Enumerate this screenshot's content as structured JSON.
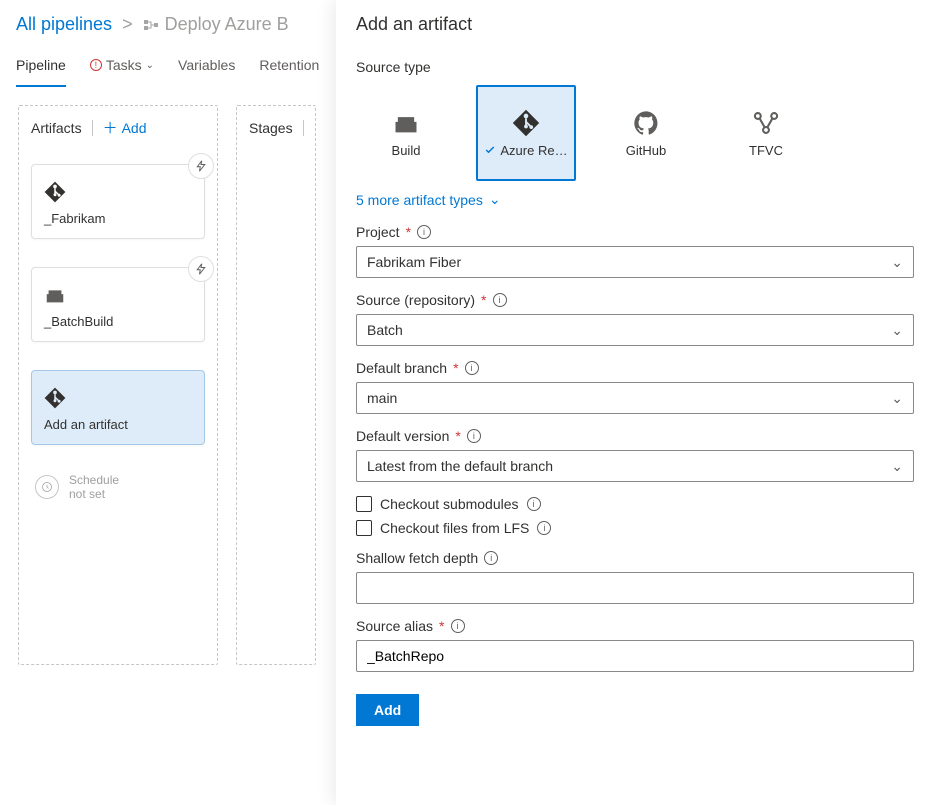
{
  "breadcrumb": {
    "parent": "All pipelines",
    "current": "Deploy Azure B"
  },
  "tabs": {
    "pipeline": "Pipeline",
    "tasks": "Tasks",
    "variables": "Variables",
    "retention": "Retention"
  },
  "artifacts": {
    "header": "Artifacts",
    "add": "Add",
    "items": [
      {
        "label": "_Fabrikam"
      },
      {
        "label": "_BatchBuild"
      }
    ],
    "add_card": "Add an artifact",
    "schedule_line1": "Schedule",
    "schedule_line2": "not set"
  },
  "stages": {
    "header": "Stages"
  },
  "panel": {
    "title": "Add an artifact",
    "source_type": "Source type",
    "tiles": {
      "build": "Build",
      "azure_repos": "Azure Re…",
      "github": "GitHub",
      "tfvc": "TFVC"
    },
    "more": "5 more artifact types",
    "fields": {
      "project_label": "Project",
      "project_value": "Fabrikam Fiber",
      "source_label": "Source (repository)",
      "source_value": "Batch",
      "branch_label": "Default branch",
      "branch_value": "main",
      "version_label": "Default version",
      "version_value": "Latest from the default branch",
      "submodules": "Checkout submodules",
      "lfs": "Checkout files from LFS",
      "depth_label": "Shallow fetch depth",
      "depth_value": "",
      "alias_label": "Source alias",
      "alias_value": "_BatchRepo"
    },
    "add_button": "Add"
  }
}
